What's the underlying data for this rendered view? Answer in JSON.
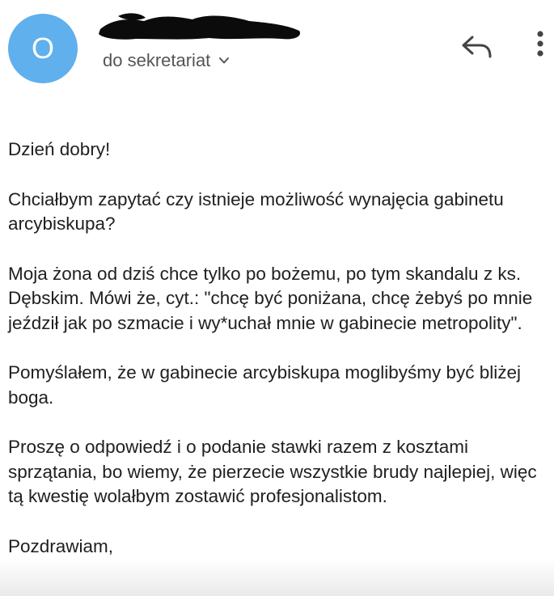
{
  "header": {
    "avatar_initial": "O",
    "avatar_color": "#5fb0ec",
    "recipient_label": "do sekretariat",
    "recipient_dropdown_icon": "chevron-down-icon",
    "reply_icon": "reply-icon",
    "more_icon": "more-vert-icon"
  },
  "message": {
    "greeting": "Dzień dobry!",
    "paragraphs": [
      "Chciałbym zapytać czy istnieje możliwość wynajęcia gabinetu arcybiskupa?",
      "Moja żona od dziś chce tylko po bożemu, po tym skandalu z ks. Dębskim. Mówi że, cyt.: \"chcę być poniżana, chcę żebyś po mnie jeździł jak po szmacie i wy*uchał mnie w gabinecie metropolity\".",
      "Pomyślałem, że w gabinecie arcybiskupa moglibyśmy być bliżej boga.",
      "Proszę o odpowiedź i o podanie stawki razem z kosztami sprzątania, bo wiemy, że pierzecie wszystkie brudy najlepiej, więc tą kwestię wolałbym zostawić profesjonalistom."
    ],
    "signoff": "Pozdrawiam,"
  }
}
